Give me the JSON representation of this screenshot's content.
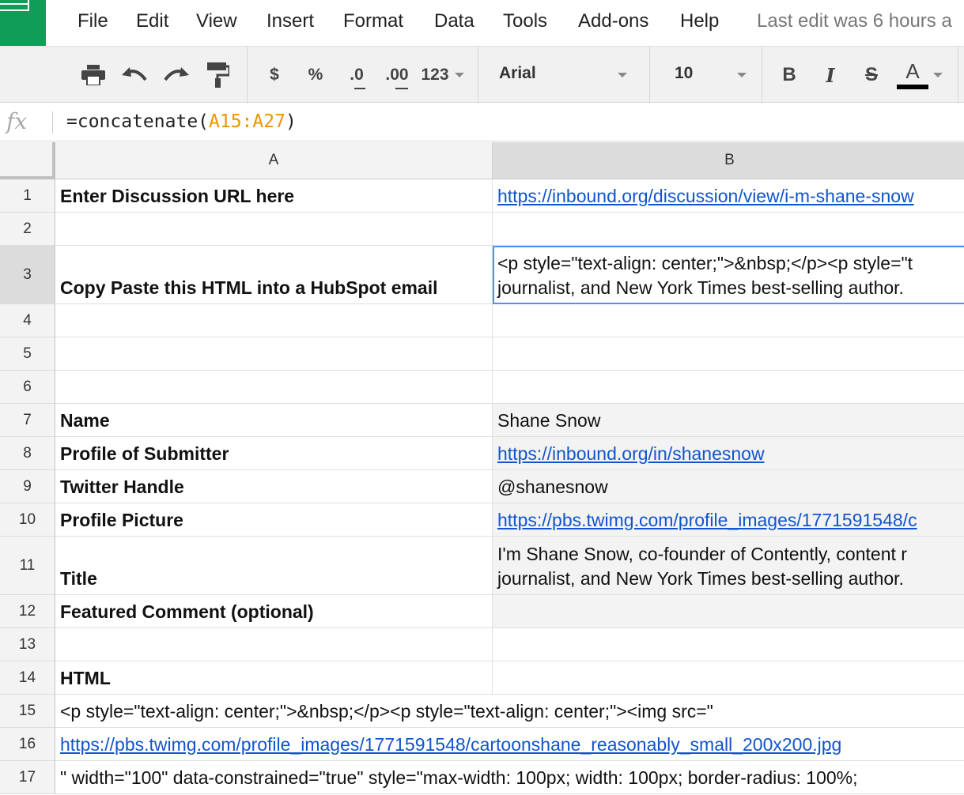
{
  "menu": {
    "items": [
      "File",
      "Edit",
      "View",
      "Insert",
      "Format",
      "Data",
      "Tools",
      "Add-ons",
      "Help"
    ],
    "last_edit": "Last edit was 6 hours a"
  },
  "toolbar": {
    "currency": "$",
    "percent": "%",
    "decrease_decimal": ".0",
    "increase_decimal": ".00",
    "more_formats": "123",
    "font": "Arial",
    "font_size": "10",
    "bold": "B",
    "italic": "I",
    "strikethrough": "S",
    "text_color": "A"
  },
  "formula_bar": {
    "icon_label": "fx",
    "prefix": "=concatenate(",
    "range": "A15:A27",
    "suffix": ")"
  },
  "columns": [
    "A",
    "B"
  ],
  "rows": [
    {
      "num": "1",
      "a": "Enter Discussion URL here",
      "b": [
        "https://inbound.org/discussion/view/i-m-shane-snow"
      ]
    },
    {
      "num": "2",
      "a": "",
      "b": []
    },
    {
      "num": "3",
      "a": "Copy Paste this HTML into a HubSpot email",
      "b": [
        "<p style=\"text-align: center;\">&nbsp;</p><p style=\"t",
        "journalist, and New York Times best-selling author."
      ]
    },
    {
      "num": "4",
      "a": "",
      "b": []
    },
    {
      "num": "5",
      "a": "",
      "b": []
    },
    {
      "num": "6",
      "a": "",
      "b": []
    },
    {
      "num": "7",
      "a": "Name",
      "b": [
        "Shane Snow"
      ]
    },
    {
      "num": "8",
      "a": "Profile of Submitter",
      "b": [
        "https://inbound.org/in/shanesnow"
      ]
    },
    {
      "num": "9",
      "a": "Twitter Handle",
      "b": [
        "@shanesnow"
      ]
    },
    {
      "num": "10",
      "a": "Profile Picture",
      "b": [
        "https://pbs.twimg.com/profile_images/1771591548/c"
      ]
    },
    {
      "num": "11",
      "a": "Title",
      "b": [
        "I'm Shane Snow, co-founder of Contently, content r",
        "journalist, and New York Times best-selling author."
      ]
    },
    {
      "num": "12",
      "a": "Featured Comment (optional)",
      "b": []
    },
    {
      "num": "13",
      "a": "",
      "b": []
    },
    {
      "num": "14",
      "a": "HTML",
      "b": []
    },
    {
      "num": "15",
      "a": "<p style=\"text-align: center;\">&nbsp;</p><p style=\"text-align: center;\"><img src=\"",
      "b": []
    },
    {
      "num": "16",
      "a": "https://pbs.twimg.com/profile_images/1771591548/cartoonshane_reasonably_small_200x200.jpg",
      "b": []
    },
    {
      "num": "17",
      "a": "\" width=\"100\" data-constrained=\"true\" style=\"max-width: 100px; width: 100px; border-radius: 100%;",
      "b": []
    }
  ]
}
